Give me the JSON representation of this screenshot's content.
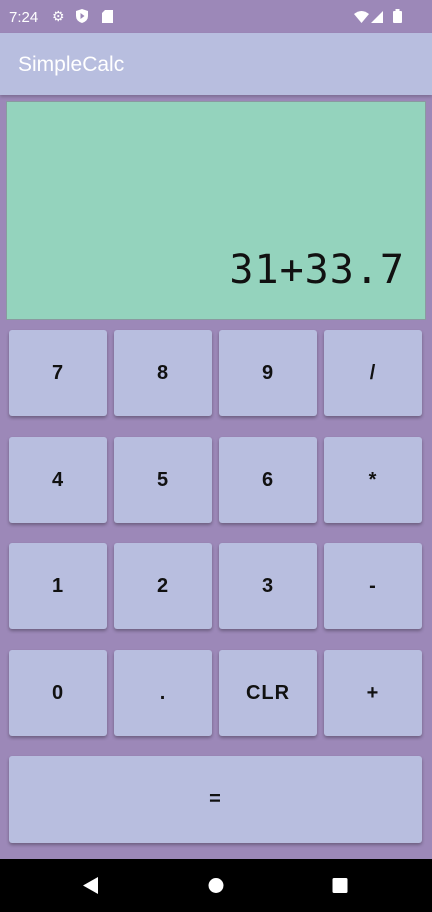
{
  "status_bar": {
    "time": "7:24",
    "icons": [
      "gear-icon",
      "shield-play-icon",
      "sd-card-icon",
      "wifi-icon",
      "signal-icon",
      "battery-icon"
    ]
  },
  "app_bar": {
    "title": "SimpleCalc"
  },
  "display": {
    "expression": "31+33.7"
  },
  "keys": [
    [
      "7",
      "8",
      "9",
      "/"
    ],
    [
      "4",
      "5",
      "6",
      "*"
    ],
    [
      "1",
      "2",
      "3",
      "-"
    ],
    [
      "0",
      ".",
      "CLR",
      "+"
    ]
  ],
  "equals": "=",
  "colors": {
    "background": "#9c88b8",
    "app_bar": "#b8bedf",
    "display": "#94d3bd",
    "button": "#b8bedf"
  }
}
